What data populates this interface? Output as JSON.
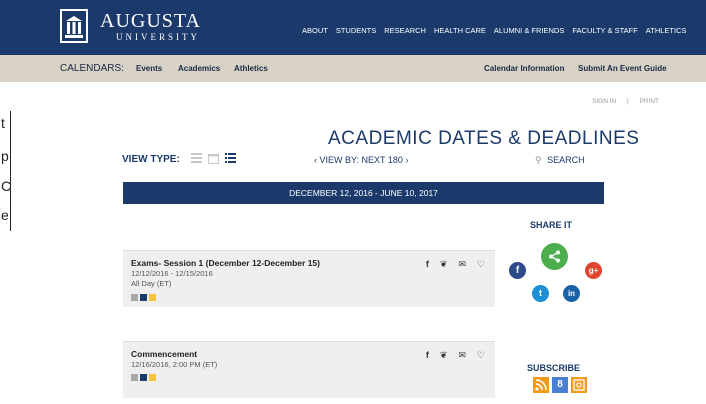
{
  "header": {
    "brand_name": "AUGUSTA",
    "brand_sub": "UNIVERSITY",
    "nav": [
      "ABOUT",
      "STUDENTS",
      "RESEARCH",
      "HEALTH CARE",
      "ALUMNI & FRIENDS",
      "FACULTY & STAFF",
      "ATHLETICS"
    ]
  },
  "subnav": {
    "label": "CALENDARS:",
    "left_items": [
      "Events",
      "Academics",
      "Athletics"
    ],
    "right_items": [
      "Calendar Information",
      "Submit An Event Guide"
    ]
  },
  "utility": {
    "signin": "SIGN IN",
    "separator": "|",
    "print": "PRINT"
  },
  "left_fragment": [
    "t",
    "p",
    "C",
    "e"
  ],
  "title": "ACADEMIC DATES & DEADLINES",
  "toolbar": {
    "view_type_label": "VIEW TYPE:",
    "view_by": "‹ VIEW BY: NEXT 180 ›",
    "search_label": "SEARCH"
  },
  "date_range": "DECEMBER 12, 2016 - JUNE 10, 2017",
  "events": [
    {
      "title": "Exams- Session 1 (December 12-December 15)",
      "dates": "12/12/2016 - 12/15/2016",
      "time": "All Day (ET)",
      "swatches": [
        "#a8a8a8",
        "#1b3a6b",
        "#f7c33a"
      ]
    },
    {
      "title": "Commencement",
      "dates": "12/16/2016, 2:00 PM (ET)",
      "time": "",
      "swatches": [
        "#a8a8a8",
        "#1b3a6b",
        "#f7c33a"
      ]
    }
  ],
  "share": {
    "title": "SHARE IT",
    "facebook": "f",
    "google": "g+",
    "twitter": "t",
    "linkedin": "in"
  },
  "subscribe": {
    "title": "SUBSCRIBE",
    "google": "8"
  },
  "colors": {
    "navy": "#1b3a6b",
    "tan": "#d7d2c5",
    "green": "#4cae4c",
    "facebook": "#2d4a8a",
    "google": "#e0452f",
    "twitter": "#1d8fd6",
    "linkedin": "#1a62a8",
    "rss": "#f39a1e"
  }
}
